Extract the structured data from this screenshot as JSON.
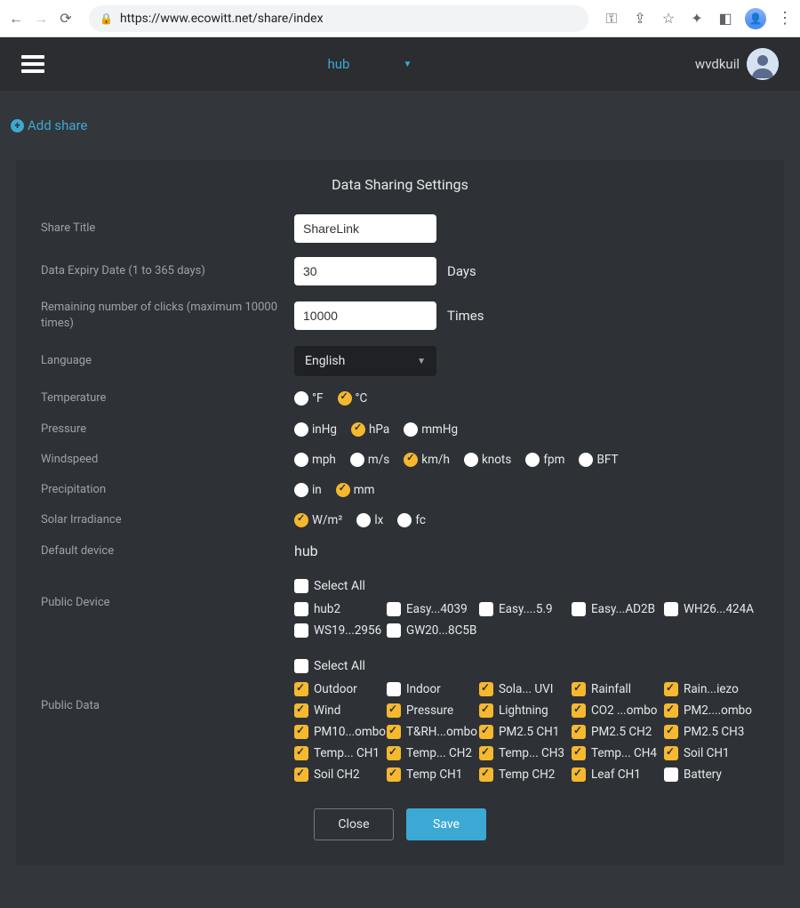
{
  "browser": {
    "url": "https://www.ecowitt.net/share/index"
  },
  "header": {
    "device_selector": "hub",
    "username": "wvdkuil"
  },
  "add_share_label": "Add share",
  "modal": {
    "title": "Data Sharing Settings",
    "fields": {
      "share_title": {
        "label": "Share Title",
        "value": "ShareLink"
      },
      "expiry": {
        "label": "Data Expiry Date (1 to 365 days)",
        "value": "30",
        "suffix": "Days"
      },
      "clicks": {
        "label": "Remaining number of clicks (maximum 10000 times)",
        "value": "10000",
        "suffix": "Times"
      },
      "language": {
        "label": "Language",
        "value": "English"
      },
      "temperature": {
        "label": "Temperature",
        "options": [
          "°F",
          "°C"
        ],
        "selected": "°C"
      },
      "pressure": {
        "label": "Pressure",
        "options": [
          "inHg",
          "hPa",
          "mmHg"
        ],
        "selected": "hPa"
      },
      "windspeed": {
        "label": "Windspeed",
        "options": [
          "mph",
          "m/s",
          "km/h",
          "knots",
          "fpm",
          "BFT"
        ],
        "selected": "km/h"
      },
      "precipitation": {
        "label": "Precipitation",
        "options": [
          "in",
          "mm"
        ],
        "selected": "mm"
      },
      "solar": {
        "label": "Solar Irradiance",
        "options": [
          "W/m²",
          "lx",
          "fc"
        ],
        "selected": "W/m²"
      },
      "default_device": {
        "label": "Default device",
        "value": "hub"
      },
      "public_device": {
        "label": "Public Device",
        "select_all": "Select All",
        "items": [
          {
            "label": "hub2",
            "checked": false
          },
          {
            "label": "Easy...4039",
            "checked": false
          },
          {
            "label": "Easy....5.9",
            "checked": false
          },
          {
            "label": "Easy...AD2B",
            "checked": false
          },
          {
            "label": "WH26...424A",
            "checked": false
          },
          {
            "label": "WS19...2956",
            "checked": false
          },
          {
            "label": "GW20...8C5B",
            "checked": false
          }
        ]
      },
      "public_data": {
        "label": "Public Data",
        "select_all": "Select All",
        "items": [
          {
            "label": "Outdoor",
            "checked": true
          },
          {
            "label": "Indoor",
            "checked": false
          },
          {
            "label": "Sola... UVI",
            "checked": true
          },
          {
            "label": "Rainfall",
            "checked": true
          },
          {
            "label": "Rain...iezo",
            "checked": true
          },
          {
            "label": "Wind",
            "checked": true
          },
          {
            "label": "Pressure",
            "checked": true
          },
          {
            "label": "Lightning",
            "checked": true
          },
          {
            "label": "CO2 ...ombo",
            "checked": true
          },
          {
            "label": "PM2....ombo",
            "checked": true
          },
          {
            "label": "PM10...ombo",
            "checked": true
          },
          {
            "label": "T&RH...ombo",
            "checked": true
          },
          {
            "label": "PM2.5 CH1",
            "checked": true
          },
          {
            "label": "PM2.5 CH2",
            "checked": true
          },
          {
            "label": "PM2.5 CH3",
            "checked": true
          },
          {
            "label": "Temp... CH1",
            "checked": true
          },
          {
            "label": "Temp... CH2",
            "checked": true
          },
          {
            "label": "Temp... CH3",
            "checked": true
          },
          {
            "label": "Temp... CH4",
            "checked": true
          },
          {
            "label": "Soil CH1",
            "checked": true
          },
          {
            "label": "Soil CH2",
            "checked": true
          },
          {
            "label": "Temp CH1",
            "checked": true
          },
          {
            "label": "Temp CH2",
            "checked": true
          },
          {
            "label": "Leaf CH1",
            "checked": true
          },
          {
            "label": "Battery",
            "checked": false
          }
        ]
      }
    },
    "buttons": {
      "close": "Close",
      "save": "Save"
    }
  }
}
